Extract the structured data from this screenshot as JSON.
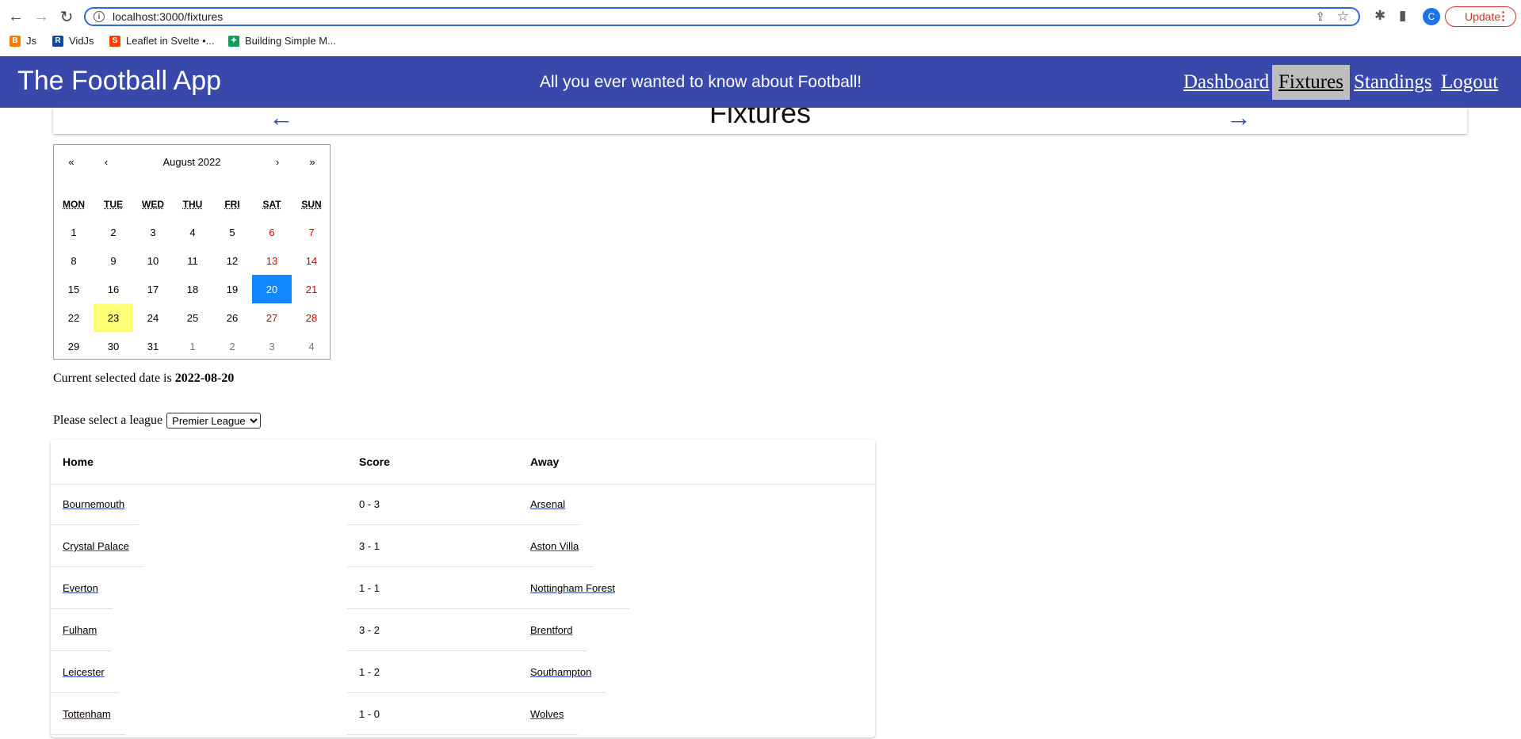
{
  "browser": {
    "url": "localhost:3000/fixtures",
    "update_label": "Update",
    "avatar_letter": "C",
    "bookmarks": [
      {
        "label": "Js",
        "icon": "blogger-icon",
        "color": "#f57c00"
      },
      {
        "label": "VidJs",
        "icon": "r-logo-icon",
        "color": "#0d47a1"
      },
      {
        "label": "Leaflet in Svelte •...",
        "icon": "svelte-icon",
        "color": "#ff3e00"
      },
      {
        "label": "Building Simple M...",
        "icon": "bookmark-leaf-icon",
        "color": "#0f9d58"
      }
    ]
  },
  "app": {
    "title": "The Football App",
    "tagline": "All you ever wanted to know about Football!",
    "nav": [
      {
        "label": "Dashboard",
        "active": false
      },
      {
        "label": "Fixtures",
        "active": true
      },
      {
        "label": "Standings",
        "active": false
      },
      {
        "label": "Logout",
        "active": false
      }
    ],
    "accent_color": "#3949ab"
  },
  "fixtures_header": {
    "title": "Fixtures",
    "prev_icon": "arrow-left-icon",
    "next_icon": "arrow-right-icon"
  },
  "calendar": {
    "nav": {
      "prev2": "«",
      "prev": "‹",
      "label": "August 2022",
      "next": "›",
      "next2": "»"
    },
    "weekdays": [
      "MON",
      "TUE",
      "WED",
      "THU",
      "FRI",
      "SAT",
      "SUN"
    ],
    "weeks": [
      [
        "1",
        "2",
        "3",
        "4",
        "5",
        "6",
        "7"
      ],
      [
        "8",
        "9",
        "10",
        "11",
        "12",
        "13",
        "14"
      ],
      [
        "15",
        "16",
        "17",
        "18",
        "19",
        "20",
        "21"
      ],
      [
        "22",
        "23",
        "24",
        "25",
        "26",
        "27",
        "28"
      ],
      [
        "29",
        "30",
        "31",
        "1",
        "2",
        "3",
        "4"
      ]
    ],
    "selected_day": "20",
    "today_day": "23",
    "selected_color": "#1087ff",
    "today_color": "#ffff76",
    "weekend_color": "#d10000"
  },
  "selection": {
    "prefix": "Current selected date is",
    "date": "2022-08-20"
  },
  "league": {
    "label": "Please select a league",
    "selected": "Premier League"
  },
  "table": {
    "headers": {
      "home": "Home",
      "score": "Score",
      "away": "Away"
    },
    "rows": [
      {
        "home": "Bournemouth",
        "score": "0 - 3",
        "away": "Arsenal"
      },
      {
        "home": "Crystal Palace",
        "score": "3 - 1",
        "away": "Aston Villa"
      },
      {
        "home": "Everton",
        "score": "1 - 1",
        "away": "Nottingham Forest"
      },
      {
        "home": "Fulham",
        "score": "3 - 2",
        "away": "Brentford"
      },
      {
        "home": "Leicester",
        "score": "1 - 2",
        "away": "Southampton"
      },
      {
        "home": "Tottenham",
        "score": "1 - 0",
        "away": "Wolves"
      }
    ]
  }
}
